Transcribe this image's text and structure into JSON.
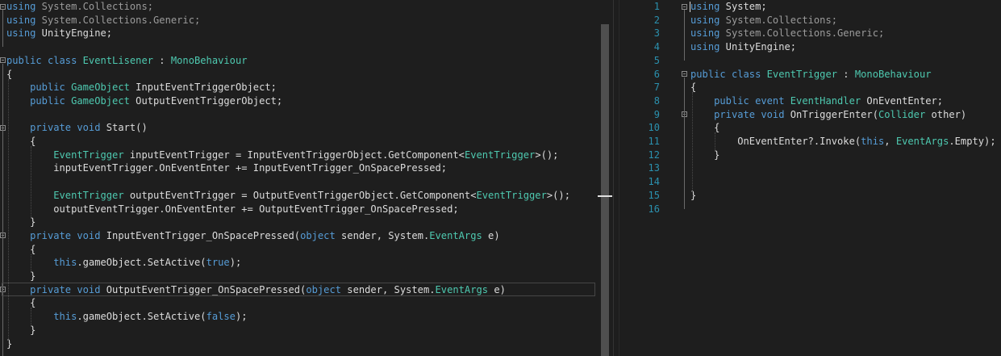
{
  "editor": {
    "left_file": {
      "lines": [
        [
          [
            "kw",
            "using"
          ],
          [
            "usingcol",
            " System.Collections;"
          ]
        ],
        [
          [
            "kw",
            "using"
          ],
          [
            "usingcol",
            " System.Collections.Generic;"
          ]
        ],
        [
          [
            "kw",
            "using"
          ],
          [
            "tx",
            " UnityEngine;"
          ]
        ],
        [],
        [
          [
            "kw",
            "public"
          ],
          [
            "tx",
            " "
          ],
          [
            "kw",
            "class"
          ],
          [
            "tx",
            " "
          ],
          [
            "ty",
            "EventLisener"
          ],
          [
            "tx",
            " : "
          ],
          [
            "ty",
            "MonoBehaviour"
          ]
        ],
        [
          [
            "tx",
            "{"
          ]
        ],
        [
          [
            "tx",
            "    "
          ],
          [
            "kw",
            "public"
          ],
          [
            "tx",
            " "
          ],
          [
            "ty",
            "GameObject"
          ],
          [
            "tx",
            " InputEventTriggerObject;"
          ]
        ],
        [
          [
            "tx",
            "    "
          ],
          [
            "kw",
            "public"
          ],
          [
            "tx",
            " "
          ],
          [
            "ty",
            "GameObject"
          ],
          [
            "tx",
            " OutputEventTriggerObject;"
          ]
        ],
        [],
        [
          [
            "tx",
            "    "
          ],
          [
            "kw",
            "private"
          ],
          [
            "tx",
            " "
          ],
          [
            "kw",
            "void"
          ],
          [
            "tx",
            " Start()"
          ]
        ],
        [
          [
            "tx",
            "    {"
          ]
        ],
        [
          [
            "tx",
            "        "
          ],
          [
            "ty",
            "EventTrigger"
          ],
          [
            "tx",
            " inputEventTrigger = InputEventTriggerObject.GetComponent<"
          ],
          [
            "ty",
            "EventTrigger"
          ],
          [
            "tx",
            ">();"
          ]
        ],
        [
          [
            "tx",
            "        inputEventTrigger.OnEventEnter += InputEventTrigger_OnSpacePressed;"
          ]
        ],
        [],
        [
          [
            "tx",
            "        "
          ],
          [
            "ty",
            "EventTrigger"
          ],
          [
            "tx",
            " outputEventTrigger = OutputEventTriggerObject.GetComponent<"
          ],
          [
            "ty",
            "EventTrigger"
          ],
          [
            "tx",
            ">();"
          ]
        ],
        [
          [
            "tx",
            "        outputEventTrigger.OnEventEnter += OutputEventTrigger_OnSpacePressed;"
          ]
        ],
        [
          [
            "tx",
            "    }"
          ]
        ],
        [
          [
            "tx",
            "    "
          ],
          [
            "kw",
            "private"
          ],
          [
            "tx",
            " "
          ],
          [
            "kw",
            "void"
          ],
          [
            "tx",
            " InputEventTrigger_OnSpacePressed("
          ],
          [
            "kw",
            "object"
          ],
          [
            "tx",
            " sender, System."
          ],
          [
            "ty",
            "EventArgs"
          ],
          [
            "tx",
            " e)"
          ]
        ],
        [
          [
            "tx",
            "    {"
          ]
        ],
        [
          [
            "tx",
            "        "
          ],
          [
            "kw",
            "this"
          ],
          [
            "tx",
            ".gameObject.SetActive("
          ],
          [
            "kw",
            "true"
          ],
          [
            "tx",
            ");"
          ]
        ],
        [
          [
            "tx",
            "    }"
          ]
        ],
        [
          [
            "tx",
            "    "
          ],
          [
            "kw",
            "private"
          ],
          [
            "tx",
            " "
          ],
          [
            "kw",
            "void"
          ],
          [
            "tx",
            " OutputEventTrigger_OnSpacePressed("
          ],
          [
            "kw",
            "object"
          ],
          [
            "tx",
            " sender, System."
          ],
          [
            "ty",
            "EventArgs"
          ],
          [
            "tx",
            " e)"
          ]
        ],
        [
          [
            "tx",
            "    {"
          ]
        ],
        [
          [
            "tx",
            "        "
          ],
          [
            "kw",
            "this"
          ],
          [
            "tx",
            ".gameObject.SetActive("
          ],
          [
            "kw",
            "false"
          ],
          [
            "tx",
            ");"
          ]
        ],
        [
          [
            "tx",
            "    }"
          ]
        ],
        [
          [
            "tx",
            "}"
          ]
        ]
      ]
    },
    "right_file": {
      "line_numbers": [
        "1",
        "2",
        "3",
        "4",
        "5",
        "6",
        "7",
        "8",
        "9",
        "10",
        "11",
        "12",
        "13",
        "14",
        "15",
        "16"
      ],
      "lines": [
        [
          [
            "kw",
            "using"
          ],
          [
            "tx",
            " System;"
          ]
        ],
        [
          [
            "kw",
            "using"
          ],
          [
            "usingcol",
            " System.Collections;"
          ]
        ],
        [
          [
            "kw",
            "using"
          ],
          [
            "usingcol",
            " System.Collections.Generic;"
          ]
        ],
        [
          [
            "kw",
            "using"
          ],
          [
            "tx",
            " UnityEngine;"
          ]
        ],
        [],
        [
          [
            "kw",
            "public"
          ],
          [
            "tx",
            " "
          ],
          [
            "kw",
            "class"
          ],
          [
            "tx",
            " "
          ],
          [
            "ty",
            "EventTrigger"
          ],
          [
            "tx",
            " : "
          ],
          [
            "ty",
            "MonoBehaviour"
          ]
        ],
        [
          [
            "tx",
            "{"
          ]
        ],
        [
          [
            "tx",
            "    "
          ],
          [
            "kw",
            "public"
          ],
          [
            "tx",
            " "
          ],
          [
            "kw",
            "event"
          ],
          [
            "tx",
            " "
          ],
          [
            "ty",
            "EventHandler"
          ],
          [
            "tx",
            " OnEventEnter;"
          ]
        ],
        [
          [
            "tx",
            "    "
          ],
          [
            "kw",
            "private"
          ],
          [
            "tx",
            " "
          ],
          [
            "kw",
            "void"
          ],
          [
            "tx",
            " OnTriggerEnter("
          ],
          [
            "ty",
            "Collider"
          ],
          [
            "tx",
            " other)"
          ]
        ],
        [
          [
            "tx",
            "    {"
          ]
        ],
        [
          [
            "tx",
            "        OnEventEnter?.Invoke("
          ],
          [
            "kw",
            "this"
          ],
          [
            "tx",
            ", "
          ],
          [
            "ty",
            "EventArgs"
          ],
          [
            "tx",
            ".Empty);"
          ]
        ],
        [
          [
            "tx",
            "    }"
          ]
        ],
        [],
        [],
        [
          [
            "tx",
            "}"
          ]
        ],
        []
      ]
    },
    "icons": {
      "split": "split-view-icon",
      "bulb": "lightbulb-icon"
    },
    "colors": {
      "background": "#1e1e1e",
      "keyword": "#569cd6",
      "type": "#4ec9b0",
      "text": "#dcdcdc",
      "line_number": "#2b91af"
    }
  }
}
